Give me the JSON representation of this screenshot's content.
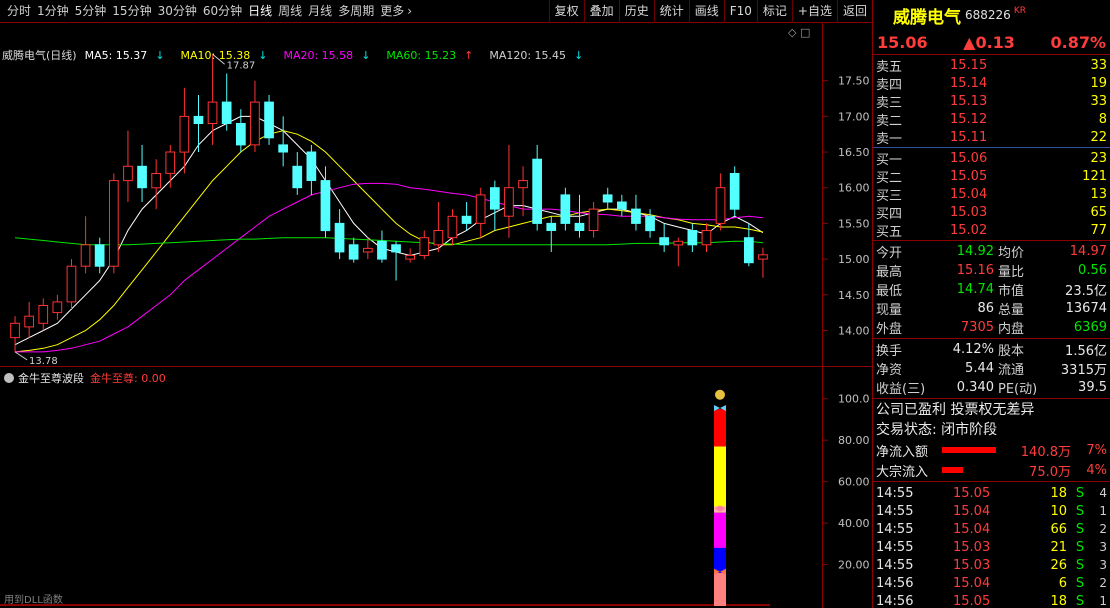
{
  "toolbar": {
    "periods": [
      "分时",
      "1分钟",
      "5分钟",
      "15分钟",
      "30分钟",
      "60分钟",
      "日线",
      "周线",
      "月线",
      "多周期",
      "更多"
    ],
    "active_period": "日线",
    "more_arrow": "›",
    "actions": [
      "复权",
      "叠加",
      "历史",
      "统计",
      "画线",
      "F10",
      "标记",
      "+自选",
      "返回"
    ]
  },
  "main_chart": {
    "title": "威腾电气(日线)",
    "ma": [
      {
        "label": "MA5: 15.37",
        "arrow": "↓",
        "color": "#ffffff",
        "arrow_color": "#00e6e6"
      },
      {
        "label": "MA10: 15.38",
        "arrow": "↓",
        "color": "#ffff00",
        "arrow_color": "#00e6e6"
      },
      {
        "label": "MA20: 15.58",
        "arrow": "↓",
        "color": "#ff00ff",
        "arrow_color": "#00e6e6"
      },
      {
        "label": "MA60: 15.23",
        "arrow": "↑",
        "color": "#00e600",
        "arrow_color": "#ff3c3c"
      },
      {
        "label": "MA120: 15.45",
        "arrow": "↓",
        "color": "#d0d0d0",
        "arrow_color": "#00e6e6"
      }
    ],
    "high_marker": "17.87",
    "low_marker": "13.78",
    "ctrl_icons": "◇ □"
  },
  "chart_data": {
    "type": "candlestick",
    "ylim": [
      13.6,
      18.0
    ],
    "y_ticks": [
      "17.50",
      "17.00",
      "16.50",
      "16.00",
      "15.50",
      "15.00",
      "14.50",
      "14.00"
    ],
    "candles": [
      {
        "o": 13.9,
        "h": 14.2,
        "l": 13.7,
        "c": 14.1
      },
      {
        "o": 14.05,
        "h": 14.4,
        "l": 13.9,
        "c": 14.2
      },
      {
        "o": 14.1,
        "h": 14.45,
        "l": 14.0,
        "c": 14.35
      },
      {
        "o": 14.25,
        "h": 14.5,
        "l": 14.15,
        "c": 14.4
      },
      {
        "o": 14.4,
        "h": 15.0,
        "l": 14.3,
        "c": 14.9
      },
      {
        "o": 14.9,
        "h": 15.6,
        "l": 14.8,
        "c": 15.2
      },
      {
        "o": 15.2,
        "h": 15.3,
        "l": 14.8,
        "c": 14.9
      },
      {
        "o": 14.9,
        "h": 16.2,
        "l": 14.8,
        "c": 16.1
      },
      {
        "o": 16.1,
        "h": 16.8,
        "l": 15.8,
        "c": 16.3
      },
      {
        "o": 16.3,
        "h": 16.6,
        "l": 15.8,
        "c": 16.0
      },
      {
        "o": 16.0,
        "h": 16.4,
        "l": 15.7,
        "c": 16.2
      },
      {
        "o": 16.2,
        "h": 16.6,
        "l": 16.0,
        "c": 16.5
      },
      {
        "o": 16.5,
        "h": 17.4,
        "l": 16.2,
        "c": 17.0
      },
      {
        "o": 17.0,
        "h": 17.3,
        "l": 16.5,
        "c": 16.9
      },
      {
        "o": 16.9,
        "h": 17.87,
        "l": 16.6,
        "c": 17.2
      },
      {
        "o": 17.2,
        "h": 17.6,
        "l": 16.8,
        "c": 16.9
      },
      {
        "o": 16.9,
        "h": 17.1,
        "l": 16.5,
        "c": 16.6
      },
      {
        "o": 16.6,
        "h": 17.5,
        "l": 16.5,
        "c": 17.2
      },
      {
        "o": 17.2,
        "h": 17.3,
        "l": 16.6,
        "c": 16.7
      },
      {
        "o": 16.6,
        "h": 17.0,
        "l": 16.3,
        "c": 16.5
      },
      {
        "o": 16.3,
        "h": 16.5,
        "l": 15.9,
        "c": 16.0
      },
      {
        "o": 16.5,
        "h": 16.6,
        "l": 15.9,
        "c": 16.1
      },
      {
        "o": 16.1,
        "h": 16.3,
        "l": 15.3,
        "c": 15.4
      },
      {
        "o": 15.5,
        "h": 15.7,
        "l": 15.0,
        "c": 15.1
      },
      {
        "o": 15.2,
        "h": 15.3,
        "l": 14.95,
        "c": 15.0
      },
      {
        "o": 15.1,
        "h": 15.3,
        "l": 15.0,
        "c": 15.15
      },
      {
        "o": 15.25,
        "h": 15.4,
        "l": 14.95,
        "c": 15.0
      },
      {
        "o": 15.2,
        "h": 15.25,
        "l": 14.7,
        "c": 15.1
      },
      {
        "o": 15.0,
        "h": 15.15,
        "l": 14.95,
        "c": 15.05
      },
      {
        "o": 15.05,
        "h": 15.4,
        "l": 15.0,
        "c": 15.3
      },
      {
        "o": 15.2,
        "h": 15.8,
        "l": 15.1,
        "c": 15.4
      },
      {
        "o": 15.3,
        "h": 15.7,
        "l": 15.2,
        "c": 15.6
      },
      {
        "o": 15.6,
        "h": 15.8,
        "l": 15.4,
        "c": 15.5
      },
      {
        "o": 15.5,
        "h": 16.0,
        "l": 15.3,
        "c": 15.9
      },
      {
        "o": 16.0,
        "h": 16.1,
        "l": 15.4,
        "c": 15.7
      },
      {
        "o": 15.6,
        "h": 16.6,
        "l": 15.3,
        "c": 16.0
      },
      {
        "o": 16.0,
        "h": 16.3,
        "l": 15.6,
        "c": 16.1
      },
      {
        "o": 16.4,
        "h": 16.6,
        "l": 15.4,
        "c": 15.5
      },
      {
        "o": 15.5,
        "h": 15.6,
        "l": 15.1,
        "c": 15.4
      },
      {
        "o": 15.9,
        "h": 16.0,
        "l": 15.4,
        "c": 15.5
      },
      {
        "o": 15.5,
        "h": 15.9,
        "l": 15.3,
        "c": 15.4
      },
      {
        "o": 15.4,
        "h": 15.8,
        "l": 15.3,
        "c": 15.7
      },
      {
        "o": 15.9,
        "h": 16.0,
        "l": 15.7,
        "c": 15.8
      },
      {
        "o": 15.8,
        "h": 15.9,
        "l": 15.6,
        "c": 15.7
      },
      {
        "o": 15.7,
        "h": 15.9,
        "l": 15.4,
        "c": 15.5
      },
      {
        "o": 15.6,
        "h": 15.7,
        "l": 15.3,
        "c": 15.4
      },
      {
        "o": 15.3,
        "h": 15.5,
        "l": 15.1,
        "c": 15.2
      },
      {
        "o": 15.2,
        "h": 15.3,
        "l": 14.9,
        "c": 15.25
      },
      {
        "o": 15.4,
        "h": 15.5,
        "l": 15.1,
        "c": 15.2
      },
      {
        "o": 15.2,
        "h": 15.5,
        "l": 15.1,
        "c": 15.4
      },
      {
        "o": 15.5,
        "h": 16.2,
        "l": 15.4,
        "c": 16.0
      },
      {
        "o": 16.2,
        "h": 16.3,
        "l": 15.6,
        "c": 15.7
      },
      {
        "o": 15.3,
        "h": 15.5,
        "l": 14.9,
        "c": 14.95
      },
      {
        "o": 15.0,
        "h": 15.16,
        "l": 14.74,
        "c": 15.06
      }
    ],
    "ma_series": [
      {
        "name": "MA5",
        "color": "#ffffff",
        "values": [
          13.8,
          13.9,
          14.0,
          14.1,
          14.3,
          14.5,
          14.7,
          15.0,
          15.4,
          15.7,
          15.9,
          16.1,
          16.3,
          16.6,
          16.8,
          16.9,
          17.0,
          17.0,
          16.9,
          16.8,
          16.6,
          16.4,
          16.1,
          15.8,
          15.5,
          15.3,
          15.15,
          15.1,
          15.05,
          15.1,
          15.15,
          15.3,
          15.4,
          15.55,
          15.65,
          15.75,
          15.75,
          15.7,
          15.65,
          15.6,
          15.6,
          15.65,
          15.7,
          15.7,
          15.65,
          15.6,
          15.5,
          15.45,
          15.4,
          15.35,
          15.5,
          15.6,
          15.5,
          15.37
        ]
      },
      {
        "name": "MA10",
        "color": "#ffff00",
        "values": [
          13.7,
          13.72,
          13.75,
          13.8,
          13.9,
          14.0,
          14.15,
          14.35,
          14.6,
          14.85,
          15.1,
          15.35,
          15.6,
          15.85,
          16.1,
          16.3,
          16.5,
          16.65,
          16.75,
          16.8,
          16.75,
          16.65,
          16.5,
          16.3,
          16.1,
          15.9,
          15.7,
          15.5,
          15.35,
          15.25,
          15.2,
          15.2,
          15.25,
          15.3,
          15.4,
          15.45,
          15.5,
          15.55,
          15.6,
          15.6,
          15.65,
          15.68,
          15.7,
          15.68,
          15.65,
          15.62,
          15.58,
          15.55,
          15.5,
          15.48,
          15.45,
          15.45,
          15.42,
          15.38
        ]
      },
      {
        "name": "MA20",
        "color": "#ff00ff",
        "values": [
          13.7,
          13.7,
          13.7,
          13.72,
          13.75,
          13.8,
          13.85,
          13.95,
          14.05,
          14.2,
          14.35,
          14.5,
          14.7,
          14.85,
          15.0,
          15.15,
          15.3,
          15.45,
          15.6,
          15.7,
          15.8,
          15.9,
          15.95,
          16.0,
          16.05,
          16.06,
          16.06,
          16.05,
          16.0,
          15.98,
          15.95,
          15.92,
          15.9,
          15.85,
          15.8,
          15.75,
          15.7,
          15.7,
          15.7,
          15.68,
          15.65,
          15.63,
          15.62,
          15.6,
          15.6,
          15.6,
          15.58,
          15.56,
          15.55,
          15.55,
          15.55,
          15.58,
          15.6,
          15.58
        ]
      },
      {
        "name": "MA60",
        "color": "#00e600",
        "values": [
          15.3,
          15.28,
          15.26,
          15.24,
          15.22,
          15.2,
          15.2,
          15.2,
          15.2,
          15.21,
          15.22,
          15.23,
          15.24,
          15.25,
          15.26,
          15.27,
          15.28,
          15.28,
          15.29,
          15.3,
          15.3,
          15.3,
          15.3,
          15.29,
          15.28,
          15.27,
          15.26,
          15.25,
          15.24,
          15.23,
          15.22,
          15.21,
          15.2,
          15.2,
          15.2,
          15.2,
          15.2,
          15.2,
          15.2,
          15.2,
          15.2,
          15.2,
          15.2,
          15.21,
          15.22,
          15.22,
          15.22,
          15.23,
          15.23,
          15.23,
          15.24,
          15.25,
          15.25,
          15.23
        ]
      }
    ],
    "sub_chart": {
      "ylim": [
        0,
        110
      ],
      "y_ticks": [
        "100.0",
        "80.00",
        "60.00",
        "40.00",
        "20.00"
      ],
      "bar_value": 100,
      "segments": [
        {
          "from": 0,
          "to": 16,
          "color": "#ff8080"
        },
        {
          "from": 16,
          "to": 28,
          "color": "#0000ff"
        },
        {
          "from": 28,
          "to": 45,
          "color": "#ff00ff"
        },
        {
          "from": 45,
          "to": 48,
          "color": "#ffb0b0"
        },
        {
          "from": 48,
          "to": 77,
          "color": "#ffff00"
        },
        {
          "from": 77,
          "to": 95,
          "color": "#ff0000"
        }
      ]
    }
  },
  "sub_chart": {
    "title": "金牛至尊波段",
    "series_label": "金牛至尊: 0.00",
    "footer": "用到DLL函数"
  },
  "quote": {
    "name": "威腾电气",
    "code": "688226",
    "tag": "KR",
    "price": "15.06",
    "change": "▲0.13",
    "change_pct": "0.87%",
    "asks": [
      {
        "label": "卖五",
        "price": "15.15",
        "vol": "33"
      },
      {
        "label": "卖四",
        "price": "15.14",
        "vol": "19"
      },
      {
        "label": "卖三",
        "price": "15.13",
        "vol": "33"
      },
      {
        "label": "卖二",
        "price": "15.12",
        "vol": "8"
      },
      {
        "label": "卖一",
        "price": "15.11",
        "vol": "22"
      }
    ],
    "bids": [
      {
        "label": "买一",
        "price": "15.06",
        "vol": "23"
      },
      {
        "label": "买二",
        "price": "15.05",
        "vol": "121"
      },
      {
        "label": "买三",
        "price": "15.04",
        "vol": "13"
      },
      {
        "label": "买四",
        "price": "15.03",
        "vol": "65"
      },
      {
        "label": "买五",
        "price": "15.02",
        "vol": "77"
      }
    ],
    "stats1": [
      {
        "l1": "今开",
        "v1": "14.92",
        "c1": "green",
        "l2": "均价",
        "v2": "14.97",
        "c2": "red"
      },
      {
        "l1": "最高",
        "v1": "15.16",
        "c1": "red",
        "l2": "量比",
        "v2": "0.56",
        "c2": "green"
      },
      {
        "l1": "最低",
        "v1": "14.74",
        "c1": "green",
        "l2": "市值",
        "v2": "23.5亿",
        "c2": "white"
      },
      {
        "l1": "现量",
        "v1": "86",
        "c1": "white",
        "l2": "总量",
        "v2": "13674",
        "c2": "white"
      },
      {
        "l1": "外盘",
        "v1": "7305",
        "c1": "red",
        "l2": "内盘",
        "v2": "6369",
        "c2": "green"
      }
    ],
    "stats2": [
      {
        "l1": "换手",
        "v1": "4.12%",
        "l2": "股本",
        "v2": "1.56亿"
      },
      {
        "l1": "净资",
        "v1": "5.44",
        "l2": "流通",
        "v2": "3315万"
      },
      {
        "l1": "收益(三)",
        "v1": "0.340",
        "l2": "PE(动)",
        "v2": "39.5"
      }
    ],
    "info1": "公司已盈利 投票权无差异",
    "info2": "交易状态: 闭市阶段",
    "flows": [
      {
        "label": "净流入额",
        "bar_fraction": 0.93,
        "value": "140.8万",
        "pct": "7%"
      },
      {
        "label": "大宗流入",
        "bar_fraction": 0.37,
        "value": "75.0万",
        "pct": "4%"
      }
    ],
    "ticks": [
      {
        "time": "14:55",
        "price": "15.05",
        "vol": "18",
        "side": "S",
        "num": "4"
      },
      {
        "time": "14:55",
        "price": "15.04",
        "vol": "10",
        "side": "S",
        "num": "1"
      },
      {
        "time": "14:55",
        "price": "15.04",
        "vol": "66",
        "side": "S",
        "num": "2"
      },
      {
        "time": "14:55",
        "price": "15.03",
        "vol": "21",
        "side": "S",
        "num": "3"
      },
      {
        "time": "14:55",
        "price": "15.03",
        "vol": "26",
        "side": "S",
        "num": "3"
      },
      {
        "time": "14:56",
        "price": "15.04",
        "vol": "6",
        "side": "S",
        "num": "2"
      },
      {
        "time": "14:56",
        "price": "15.05",
        "vol": "18",
        "side": "S",
        "num": "1"
      }
    ]
  }
}
